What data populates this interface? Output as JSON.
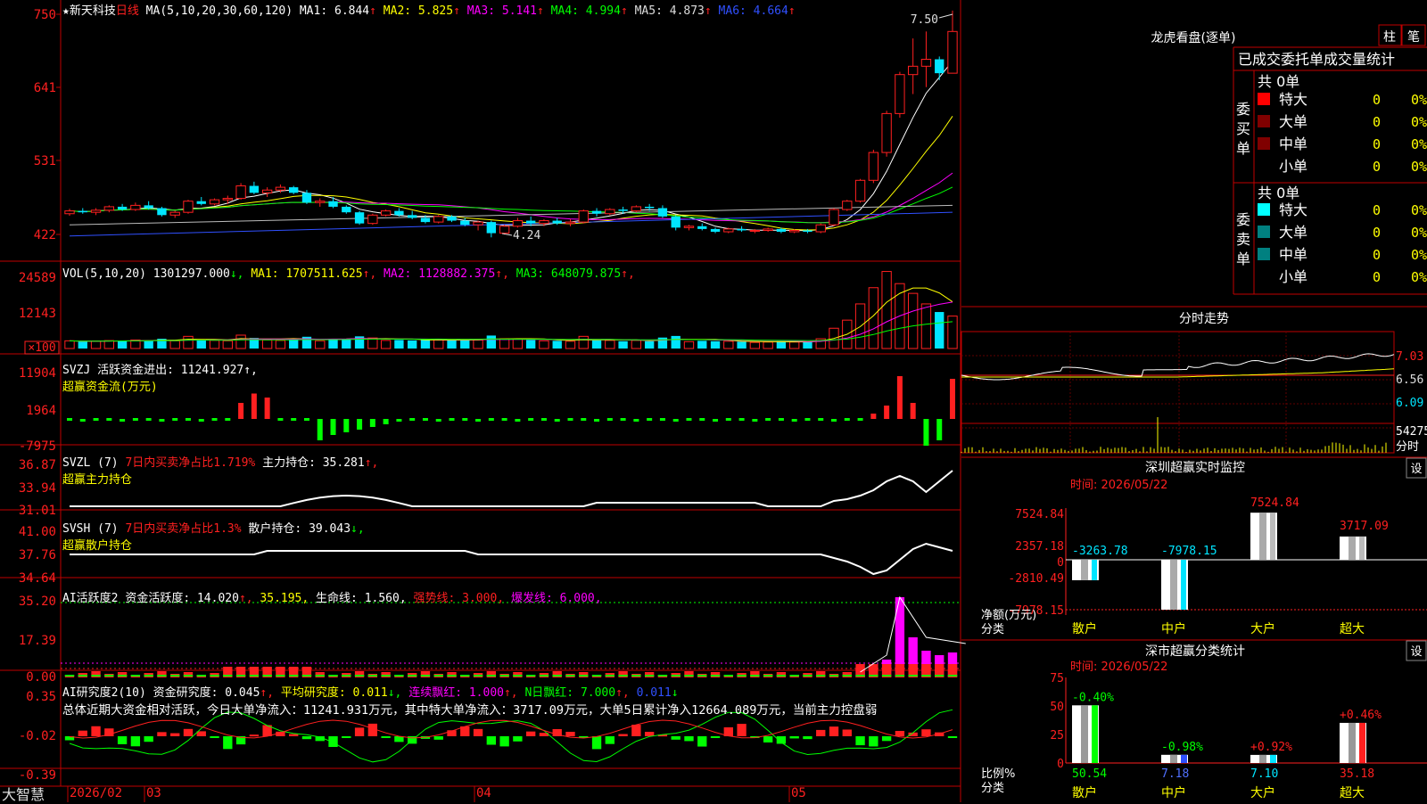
{
  "colors": {
    "up": "#ff2020",
    "down": "#00e5ff",
    "frame": "#c00000",
    "bg": "#000000",
    "yellow": "#ffff00",
    "magenta": "#ff00ff",
    "green": "#00ff00",
    "white": "#ffffff",
    "blue": "#3050ff"
  },
  "header": {
    "stock": "★新天科技",
    "period": "日线",
    "ma_title": "MA(5,10,20,30,60,120)",
    "ma": [
      {
        "label": "MA1:",
        "value": "6.844",
        "arrow": "↑",
        "color": "#ffffff"
      },
      {
        "label": "MA2:",
        "value": "5.825",
        "arrow": "↑",
        "color": "#ffff00"
      },
      {
        "label": "MA3:",
        "value": "5.141",
        "arrow": "↑",
        "color": "#ff00ff"
      },
      {
        "label": "MA4:",
        "value": "4.994",
        "arrow": "↑",
        "color": "#00ff00"
      },
      {
        "label": "MA5:",
        "value": "4.873",
        "arrow": "↑",
        "color": "#dddddd"
      },
      {
        "label": "MA6:",
        "value": "4.664",
        "arrow": "↑",
        "color": "#3050ff"
      }
    ]
  },
  "price_axis": [
    "750",
    "641",
    "531",
    "422"
  ],
  "price_marks": {
    "high_label": "7.50",
    "low_label": "4.24"
  },
  "vol": {
    "title": "VOL(5,10,20)",
    "value": "1301297.000",
    "ma": [
      {
        "label": "MA1:",
        "value": "1707511.625",
        "color": "#ffff00"
      },
      {
        "label": "MA2:",
        "value": "1128882.375",
        "color": "#ff00ff"
      },
      {
        "label": "MA3:",
        "value": "648079.875",
        "color": "#00ff00"
      }
    ],
    "axis": [
      "24589",
      "12143",
      "×100"
    ]
  },
  "svzj": {
    "title": "SVZJ",
    "label": "活跃资金进出:",
    "value": "11241.927",
    "sub": "超赢资金流(万元)",
    "axis": [
      "11904",
      "1964",
      "-7975"
    ]
  },
  "svzl": {
    "title": "SVZL (7)",
    "label1": "7日内买卖净占比1.719%",
    "label2": "主力持仓:",
    "value": "35.281",
    "sub": "超赢主力持仓",
    "axis": [
      "36.87",
      "33.94",
      "31.01"
    ]
  },
  "svsh": {
    "title": "SVSH (7)",
    "label1": "7日内买卖净占比1.3%",
    "label2": "散户持仓:",
    "value": "39.043",
    "sub": "超赢散户持仓",
    "axis": [
      "41.00",
      "37.76",
      "34.64"
    ]
  },
  "ai_active": {
    "title": "AI活跃度2",
    "label": "资金活跃度:",
    "value": "14.020",
    "v2": "35.195,",
    "life": "生命线:",
    "life_v": "1.560,",
    "strong": "强势线:",
    "strong_v": "3.000,",
    "burst": "爆发线:",
    "burst_v": "6.000,",
    "axis": [
      "35.20",
      "17.39",
      "0.00"
    ]
  },
  "ai_research": {
    "title": "AI研究度2(10)",
    "label": "资金研究度:",
    "value": "0.045",
    "avg": "平均研究度:",
    "avg_v": "0.011",
    "cont": "连续飘红:",
    "cont_v": "1.000",
    "nday": "N日飘红:",
    "nday_v": "7.000",
    "last": "0.011",
    "axis": [
      "0.35",
      "-0.02",
      "-0.39"
    ],
    "summary": "总体近期大资金相对活跃，今日大单净流入：11241.931万元，其中特大单净流入：3717.09万元，大单5日累计净入12664.089万元，当前主力控盘弱"
  },
  "bottom": {
    "brand": "大智慧",
    "dates": [
      "2026/02",
      "03",
      "04",
      "05"
    ]
  },
  "right": {
    "tabs": [
      "柱",
      "笔"
    ],
    "dragon_title": "龙虎看盘(逐单)",
    "stats_title": "已成交委托单成交量统计",
    "buy_label": "委买单",
    "sell_label": "委卖单",
    "buy_total": "共 0单",
    "sell_total": "共 0单",
    "rows": [
      "特大",
      "大单",
      "中单",
      "小单"
    ],
    "zero": "0",
    "pct": "0%",
    "buy_colors": [
      "#ff0000",
      "#800000",
      "#800000",
      "#000000"
    ],
    "sell_colors": [
      "#00ffff",
      "#008080",
      "#008080",
      "#000000"
    ],
    "intraday_title": "分时走势",
    "intraday_axis": [
      "7.03",
      "6.56",
      "6.09",
      "54275"
    ],
    "intraday_unit": "分时",
    "sz_title": "深圳超赢实时监控",
    "sz_set": "设",
    "sz_time": "时间: 2026/05/22",
    "sz_axis": [
      "7524.84",
      "2357.18",
      "0",
      "-2810.49",
      "-7978.15"
    ],
    "sz_ylabel": "净额(万元)",
    "sz_xlabel": "分类",
    "cat_names": [
      "散户",
      "中户",
      "大户",
      "超大"
    ],
    "sz_values": [
      "-3263.78",
      "-7978.15",
      "7524.84",
      "3717.09"
    ],
    "cls_title": "深市超赢分类统计",
    "cls_set": "设",
    "cls_time": "时间: 2026/05/22",
    "cls_axis": [
      "75",
      "50",
      "25",
      "0"
    ],
    "cls_ylabel": "比例%",
    "cls_xlabel": "分类",
    "cls_changes": [
      "-0.40%",
      "-0.98%",
      "+0.92%",
      "+0.46%"
    ],
    "cls_values": [
      "50.54",
      "7.18",
      "7.10",
      "35.18"
    ]
  },
  "chart_data": {
    "type": "candlestick",
    "title": "新天科技 日线",
    "price_range": [
      4.22,
      7.5
    ],
    "dates_visible": [
      "2026/02",
      "03",
      "04",
      "05"
    ],
    "candles_ohlc": [
      [
        4.58,
        4.65,
        4.55,
        4.62
      ],
      [
        4.62,
        4.66,
        4.58,
        4.6
      ],
      [
        4.6,
        4.66,
        4.56,
        4.63
      ],
      [
        4.63,
        4.7,
        4.6,
        4.68
      ],
      [
        4.68,
        4.72,
        4.62,
        4.64
      ],
      [
        4.64,
        4.74,
        4.62,
        4.7
      ],
      [
        4.7,
        4.76,
        4.64,
        4.66
      ],
      [
        4.66,
        4.68,
        4.54,
        4.56
      ],
      [
        4.56,
        4.62,
        4.52,
        4.6
      ],
      [
        4.6,
        4.78,
        4.58,
        4.76
      ],
      [
        4.76,
        4.82,
        4.7,
        4.72
      ],
      [
        4.72,
        4.8,
        4.7,
        4.78
      ],
      [
        4.78,
        4.84,
        4.72,
        4.8
      ],
      [
        4.8,
        5.02,
        4.78,
        4.98
      ],
      [
        4.98,
        5.04,
        4.86,
        4.88
      ],
      [
        4.88,
        4.96,
        4.82,
        4.92
      ],
      [
        4.92,
        5.0,
        4.88,
        4.96
      ],
      [
        4.96,
        4.98,
        4.86,
        4.88
      ],
      [
        4.88,
        4.92,
        4.72,
        4.74
      ],
      [
        4.74,
        4.8,
        4.68,
        4.76
      ],
      [
        4.76,
        4.82,
        4.66,
        4.68
      ],
      [
        4.68,
        4.7,
        4.58,
        4.6
      ],
      [
        4.6,
        4.62,
        4.42,
        4.44
      ],
      [
        4.44,
        4.58,
        4.42,
        4.56
      ],
      [
        4.56,
        4.64,
        4.54,
        4.62
      ],
      [
        4.62,
        4.66,
        4.54,
        4.56
      ],
      [
        4.56,
        4.62,
        4.5,
        4.52
      ],
      [
        4.52,
        4.56,
        4.44,
        4.46
      ],
      [
        4.46,
        4.56,
        4.44,
        4.54
      ],
      [
        4.54,
        4.56,
        4.46,
        4.48
      ],
      [
        4.48,
        4.52,
        4.4,
        4.42
      ],
      [
        4.42,
        4.48,
        4.34,
        4.46
      ],
      [
        4.46,
        4.48,
        4.24,
        4.3
      ],
      [
        4.3,
        4.42,
        4.28,
        4.4
      ],
      [
        4.4,
        4.52,
        4.38,
        4.48
      ],
      [
        4.48,
        4.54,
        4.4,
        4.44
      ],
      [
        4.44,
        4.5,
        4.4,
        4.48
      ],
      [
        4.48,
        4.52,
        4.42,
        4.44
      ],
      [
        4.44,
        4.5,
        4.4,
        4.46
      ],
      [
        4.46,
        4.64,
        4.44,
        4.62
      ],
      [
        4.62,
        4.66,
        4.54,
        4.58
      ],
      [
        4.58,
        4.66,
        4.56,
        4.64
      ],
      [
        4.64,
        4.68,
        4.58,
        4.62
      ],
      [
        4.62,
        4.7,
        4.6,
        4.68
      ],
      [
        4.68,
        4.72,
        4.62,
        4.66
      ],
      [
        4.66,
        4.7,
        4.52,
        4.54
      ],
      [
        4.54,
        4.56,
        4.34,
        4.38
      ],
      [
        4.38,
        4.42,
        4.34,
        4.4
      ],
      [
        4.4,
        4.44,
        4.34,
        4.36
      ],
      [
        4.36,
        4.38,
        4.3,
        4.32
      ],
      [
        4.32,
        4.38,
        4.3,
        4.36
      ],
      [
        4.36,
        4.4,
        4.32,
        4.34
      ],
      [
        4.34,
        4.36,
        4.3,
        4.34
      ],
      [
        4.34,
        4.38,
        4.32,
        4.36
      ],
      [
        4.36,
        4.38,
        4.3,
        4.32
      ],
      [
        4.32,
        4.36,
        4.3,
        4.34
      ],
      [
        4.34,
        4.36,
        4.3,
        4.32
      ],
      [
        4.32,
        4.44,
        4.3,
        4.42
      ],
      [
        4.42,
        4.66,
        4.4,
        4.64
      ],
      [
        4.64,
        4.78,
        4.62,
        4.76
      ],
      [
        4.76,
        5.08,
        4.74,
        5.06
      ],
      [
        5.06,
        5.5,
        5.02,
        5.46
      ],
      [
        5.46,
        6.06,
        5.4,
        6.02
      ],
      [
        6.02,
        6.62,
        5.96,
        6.58
      ],
      [
        6.58,
        7.1,
        6.3,
        6.7
      ],
      [
        6.7,
        7.2,
        6.4,
        6.8
      ],
      [
        6.8,
        6.84,
        6.5,
        6.6
      ],
      [
        6.6,
        7.5,
        6.6,
        7.2
      ]
    ]
  }
}
